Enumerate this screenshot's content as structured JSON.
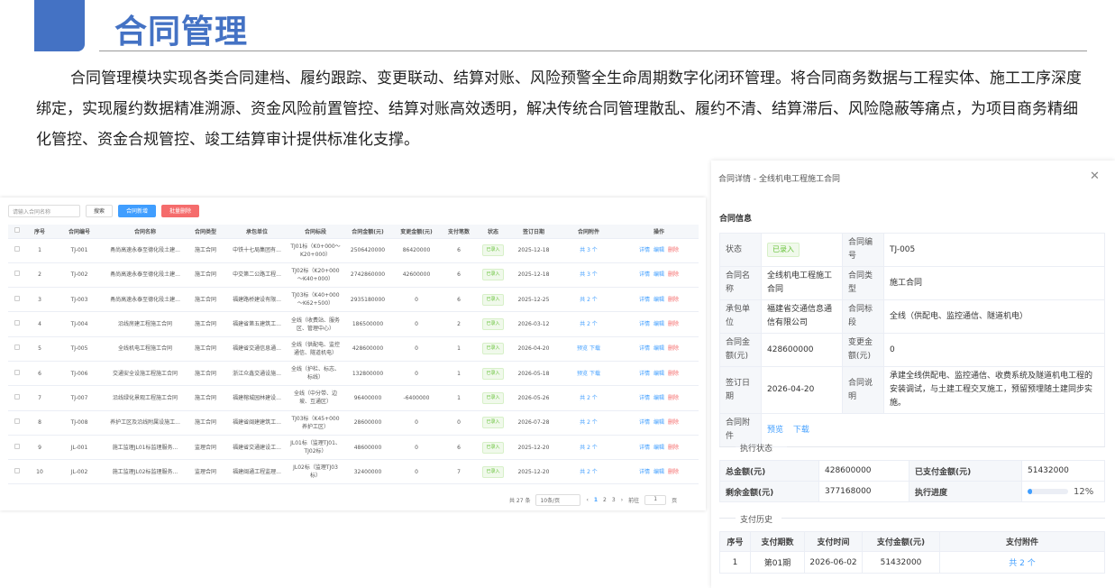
{
  "header": {
    "title": "合同管理",
    "intro": "合同管理模块实现各类合同建档、履约跟踪、变更联动、结算对账、风险预警全生命周期数字化闭环管理。将合同商务数据与工程实体、施工工序深度绑定，实现履约数据精准溯源、资金风险前置管控、结算对账高效透明，解决传统合同管理散乱、履约不清、结算滞后、风险隐蔽等痛点，为项目商务精细化管控、资金合规管控、竣工结算审计提供标准化支撑。"
  },
  "list": {
    "search_placeholder": "请输入合同名称",
    "search_button": "搜索",
    "add_button": "合同新增",
    "batch_delete_button": "批量删除",
    "columns": [
      "序号",
      "合同编号",
      "合同名称",
      "合同类型",
      "承包单位",
      "合同标段",
      "合同金额(元)",
      "变更金额(元)",
      "支付笔数",
      "状态",
      "签订日期",
      "合同附件",
      "操作"
    ],
    "rows": [
      {
        "no": "1",
        "code": "TJ-001",
        "name": "甬尚高速永泰至德化段土建...",
        "type": "施工合同",
        "unit": "中铁十七局集团有...",
        "section": "TJ01标（K0+000～K20+000）",
        "amount": "2506420000",
        "change": "86420000",
        "pays": "6",
        "status": "已录入",
        "date": "2025-12-18",
        "attach": "共 3 个"
      },
      {
        "no": "2",
        "code": "TJ-002",
        "name": "甬尚高速永泰至德化段土建...",
        "type": "施工合同",
        "unit": "中交第二公路工程...",
        "section": "TJ02标（K20+000～K40+000）",
        "amount": "2742860000",
        "change": "42600000",
        "pays": "6",
        "status": "已录入",
        "date": "2025-12-18",
        "attach": "共 3 个"
      },
      {
        "no": "3",
        "code": "TJ-003",
        "name": "甬尚高速永泰至德化段土建...",
        "type": "施工合同",
        "unit": "福建路桥建设有限...",
        "section": "TJ03标（K40+000～K62+500）",
        "amount": "2935180000",
        "change": "0",
        "pays": "6",
        "status": "已录入",
        "date": "2025-12-25",
        "attach": "共 2 个"
      },
      {
        "no": "4",
        "code": "TJ-004",
        "name": "沿线房建工程施工合同",
        "type": "施工合同",
        "unit": "福建省第五建筑工...",
        "section": "全线（收费站、服务区、管理中心）",
        "amount": "186500000",
        "change": "0",
        "pays": "2",
        "status": "已录入",
        "date": "2026-03-12",
        "attach": "共 2 个"
      },
      {
        "no": "5",
        "code": "TJ-005",
        "name": "全线机电工程施工合同",
        "type": "施工合同",
        "unit": "福建省交通信息通...",
        "section": "全线（供配电、监控通信、隧道机电）",
        "amount": "428600000",
        "change": "0",
        "pays": "1",
        "status": "已录入",
        "date": "2026-04-20",
        "attach": "预览 下载"
      },
      {
        "no": "6",
        "code": "TJ-006",
        "name": "交通安全设施工程施工合同",
        "type": "施工合同",
        "unit": "浙江众鑫交通设施...",
        "section": "全线（护栏、标志、标线）",
        "amount": "132800000",
        "change": "0",
        "pays": "1",
        "status": "已录入",
        "date": "2026-05-18",
        "attach": "预览 下载"
      },
      {
        "no": "7",
        "code": "TJ-007",
        "name": "沿线绿化景观工程施工合同",
        "type": "施工合同",
        "unit": "福建榕城园林建设...",
        "section": "全线（中分带、边坡、互通区）",
        "amount": "96400000",
        "change": "-6400000",
        "pays": "1",
        "status": "已录入",
        "date": "2026-05-26",
        "attach": "共 2 个"
      },
      {
        "no": "8",
        "code": "TJ-008",
        "name": "养护工区及沿线附属设施工...",
        "type": "施工合同",
        "unit": "福建省闽建建筑工...",
        "section": "TJ03标（K45+000养护工区）",
        "amount": "28600000",
        "change": "0",
        "pays": "0",
        "status": "已录入",
        "date": "2026-07-28",
        "attach": "共 2 个"
      },
      {
        "no": "9",
        "code": "JL-001",
        "name": "施工监理JL01标监理服务...",
        "type": "监理合同",
        "unit": "福建省交通建设工...",
        "section": "JL01标（监理TJ01、TJ02标）",
        "amount": "48600000",
        "change": "0",
        "pays": "6",
        "status": "已录入",
        "date": "2025-12-20",
        "attach": "共 2 个"
      },
      {
        "no": "10",
        "code": "JL-002",
        "name": "施工监理JL02标监理服务...",
        "type": "监理合同",
        "unit": "福建闽通工程监理...",
        "section": "JL02标（监理TJ03标）",
        "amount": "32400000",
        "change": "0",
        "pays": "7",
        "status": "已录入",
        "date": "2025-12-20",
        "attach": "共 2 个"
      }
    ],
    "ops": {
      "detail": "详情",
      "edit": "编辑",
      "delete": "删除"
    },
    "pager": {
      "total": "共 27 条",
      "size": "10条/页",
      "pages": [
        "1",
        "2",
        "3"
      ],
      "goto": "前往",
      "goto_value": "1",
      "unit": "页"
    }
  },
  "detail": {
    "title": "合同详情 - 全线机电工程施工合同",
    "section_info": "合同信息",
    "labels": {
      "status": "状态",
      "code": "合同编号",
      "name": "合同名称",
      "type": "合同类型",
      "unit": "承包单位",
      "section": "合同标段",
      "amount": "合同金额(元)",
      "change": "变更金额(元)",
      "date": "签订日期",
      "desc": "合同说明",
      "attach": "合同附件"
    },
    "values": {
      "status": "已录入",
      "code": "TJ-005",
      "name": "全线机电工程施工合同",
      "type": "施工合同",
      "unit": "福建省交通信息通信有限公司",
      "section": "全线（供配电、监控通信、隧道机电）",
      "amount": "428600000",
      "change": "0",
      "date": "2026-04-20",
      "desc": "承建全线供配电、监控通信、收费系统及隧道机电工程的安装调试，与土建工程交叉施工，预留预埋随土建同步实施。",
      "preview": "预览",
      "download": "下载"
    },
    "section_exec": "执行状态",
    "exec": {
      "total_label": "总金额(元)",
      "total": "428600000",
      "paid_label": "已支付金额(元)",
      "paid": "51432000",
      "remain_label": "剩余金额(元)",
      "remain": "377168000",
      "progress_label": "执行进度",
      "progress": "12%",
      "progress_value": 12
    },
    "section_pay": "支付历史",
    "pay_columns": [
      "序号",
      "支付期数",
      "支付时间",
      "支付金额(元)",
      "支付附件"
    ],
    "pay_rows": [
      {
        "no": "1",
        "period": "第01期",
        "time": "2026-06-02",
        "amount": "51432000",
        "attach": "共 2 个"
      }
    ]
  }
}
